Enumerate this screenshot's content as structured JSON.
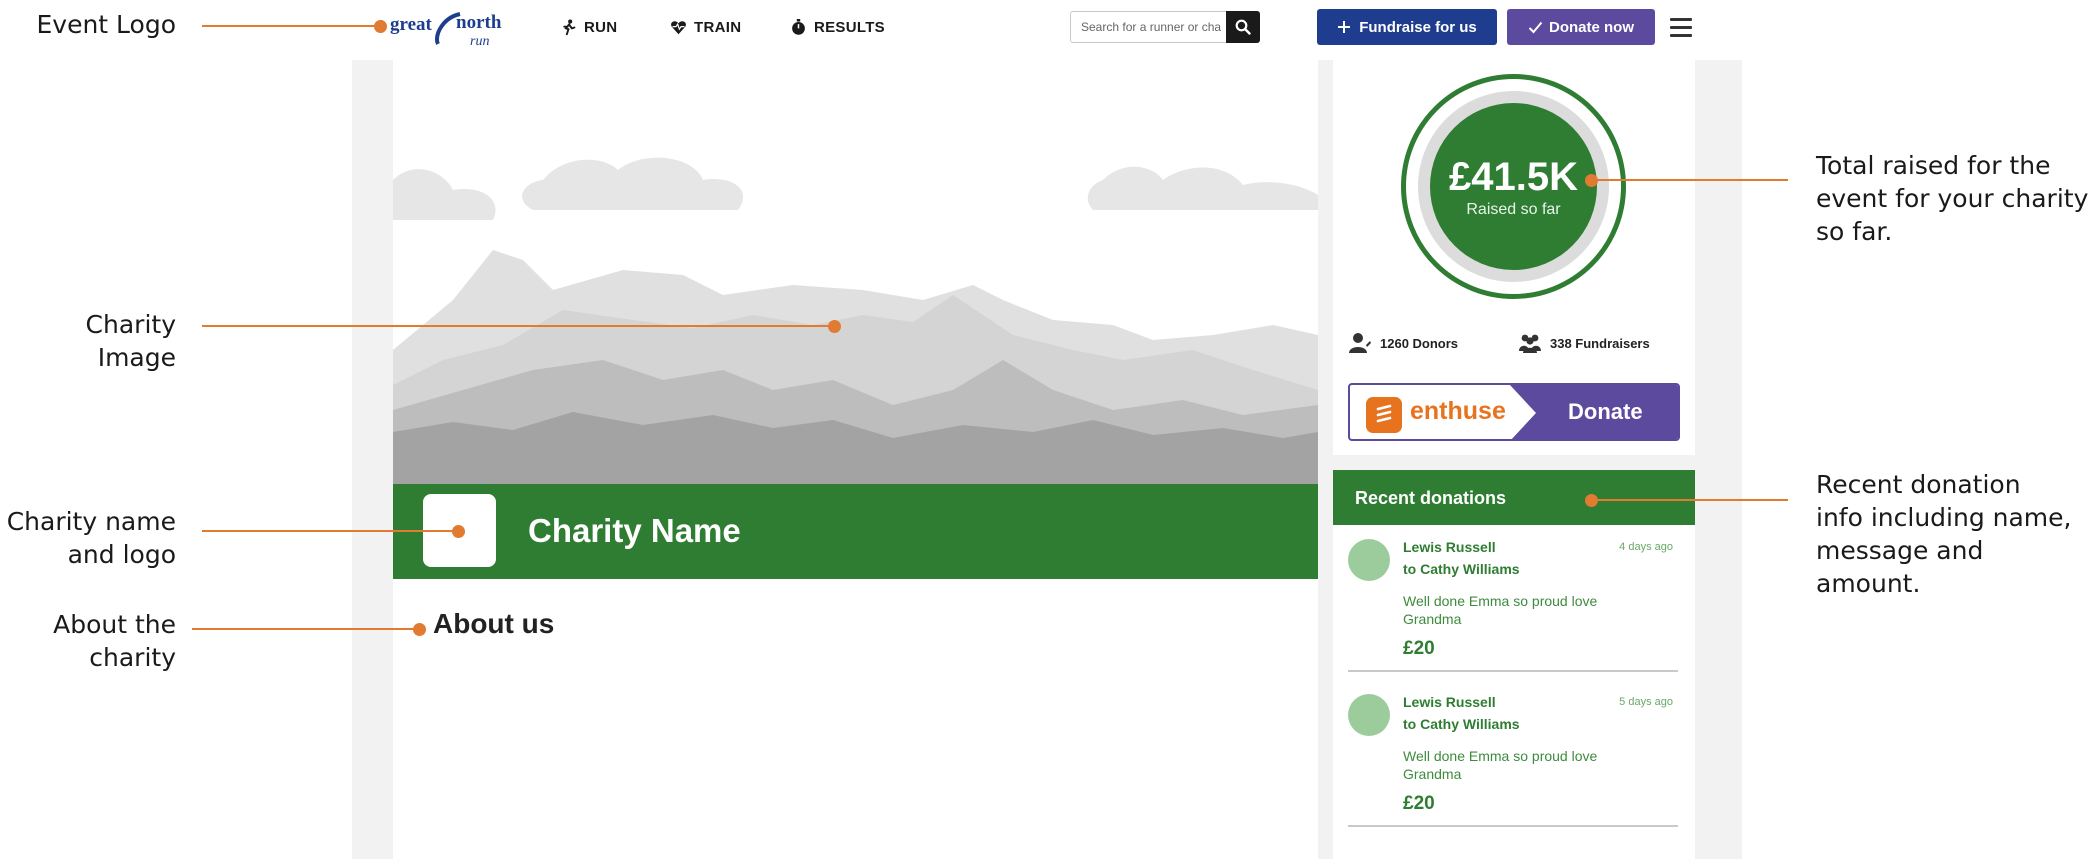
{
  "annotations": {
    "event_logo": "Event  Logo",
    "charity_image": "Charity Image",
    "charity_name_logo_line1": "Charity name",
    "charity_name_logo_line2": "and  logo",
    "about_line1": "About the",
    "about_line2": "charity",
    "total_line1": "Total raised for the",
    "total_line2": "event for your charity",
    "total_line3": "so far.",
    "recent_line1": "Recent donation",
    "recent_line2": "info including name,",
    "recent_line3": "message and amount."
  },
  "header": {
    "logo_word1": "great",
    "logo_word2": "north",
    "logo_word3": "run",
    "nav": [
      {
        "label": "RUN",
        "icon": "runner-icon"
      },
      {
        "label": "TRAIN",
        "icon": "heart-pulse-icon"
      },
      {
        "label": "RESULTS",
        "icon": "stopwatch-icon"
      }
    ],
    "search_placeholder": "Search for a runner or charity",
    "fundraise_label": "Fundraise for us",
    "donate_label": "Donate now"
  },
  "charity": {
    "name": "Charity Name",
    "about_title": "About us"
  },
  "stats": {
    "raised_amount": "£41.5K",
    "raised_label": "Raised so far",
    "donors": "1260 Donors",
    "fundraisers": "338 Fundraisers"
  },
  "donate_widget": {
    "brand": "enthuse",
    "action": "Donate"
  },
  "recent": {
    "title": "Recent donations",
    "items": [
      {
        "donor": "Lewis Russell",
        "recipient": "to Cathy Williams",
        "time": "4 days ago",
        "message": "Well done Emma so proud love Grandma",
        "amount": "£20"
      },
      {
        "donor": "Lewis Russell",
        "recipient": "to Cathy Williams",
        "time": "5 days ago",
        "message": "Well done Emma so proud love Grandma",
        "amount": "£20"
      }
    ]
  },
  "colors": {
    "accent_green": "#2e7d32",
    "fundraise_blue": "#1e3d8f",
    "donate_purple": "#5b4a9e",
    "enthuse_orange": "#e8731f",
    "annotation_orange": "#e07b31"
  }
}
